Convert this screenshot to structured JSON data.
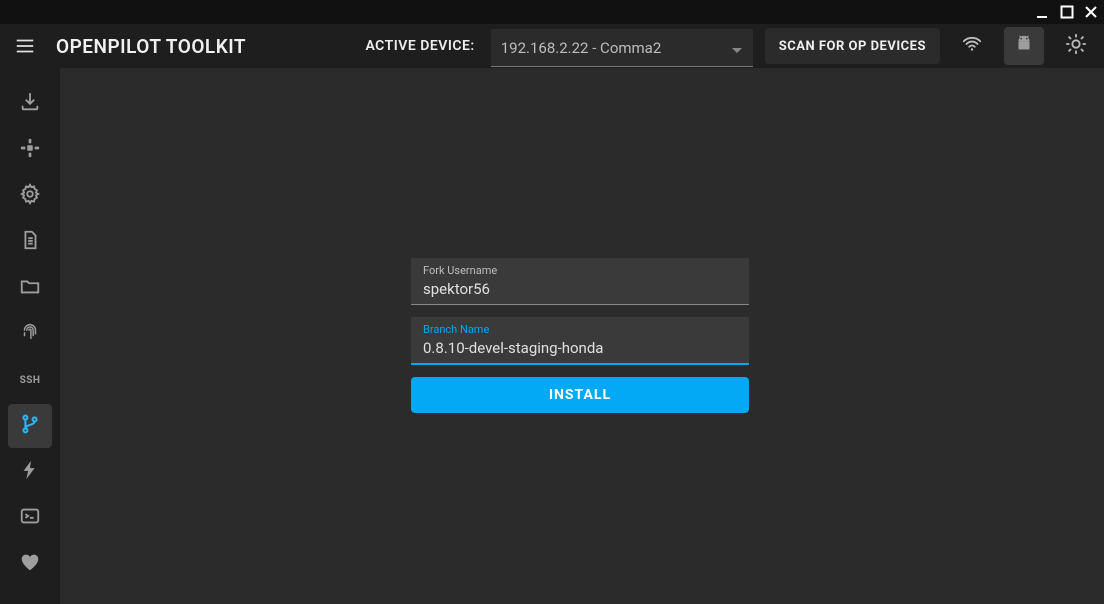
{
  "app": {
    "title": "OPENPILOT TOOLKIT"
  },
  "header": {
    "active_device_label": "ACTIVE DEVICE:",
    "device_value": "192.168.2.22 - Comma2",
    "scan_label": "SCAN FOR OP DEVICES"
  },
  "sidebar": {
    "ssh_label": "SSH"
  },
  "form": {
    "fork_label": "Fork Username",
    "fork_value": "spektor56",
    "branch_label": "Branch Name",
    "branch_value": "0.8.10-devel-staging-honda",
    "install_label": "INSTALL"
  }
}
